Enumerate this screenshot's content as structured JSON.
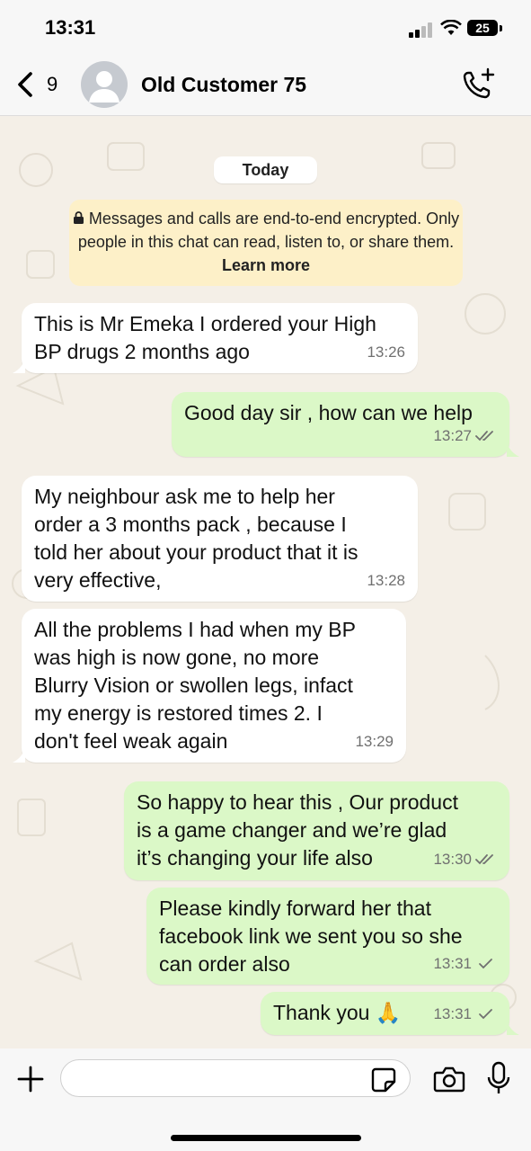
{
  "status": {
    "time": "13:31",
    "battery": "25"
  },
  "header": {
    "back_count": "9",
    "contact_name": "Old Customer 75"
  },
  "chat": {
    "date_label": "Today",
    "encryption": {
      "text": "Messages and calls are end-to-end encrypted. Only people in this chat can read, listen to, or share them.",
      "link": "Learn more"
    },
    "messages": [
      {
        "direction": "in",
        "text": "This is Mr Emeka I ordered your High\nBP drugs 2 months ago",
        "time": "13:26"
      },
      {
        "direction": "out",
        "text": "Good day sir , how can we help",
        "time": "13:27",
        "status": "read"
      },
      {
        "direction": "in",
        "text": "My neighbour ask me  to help her\norder a 3 months pack , because I\ntold her about your product that it  is\nvery effective,",
        "time": "13:28"
      },
      {
        "direction": "in",
        "text": "All the problems I had when my BP\nwas high is now gone, no more\nBlurry Vision or swollen legs, infact\nmy energy is restored times 2. I\ndon't feel weak again",
        "time": "13:29"
      },
      {
        "direction": "out",
        "text": "So happy to hear this , Our product\nis a game changer and we’re glad\nit’s changing your life also",
        "time": "13:30",
        "status": "read"
      },
      {
        "direction": "out",
        "text": "Please kindly forward her that\nfacebook link we sent you so she\ncan order also",
        "time": "13:31",
        "status": "sent"
      },
      {
        "direction": "out",
        "text": "Thank you 🙏",
        "time": "13:31",
        "status": "sent"
      }
    ]
  },
  "colors": {
    "incoming": "#ffffff",
    "outgoing": "#dbf8c7",
    "notice": "#fdf0c8",
    "tick_read": "#707070"
  }
}
